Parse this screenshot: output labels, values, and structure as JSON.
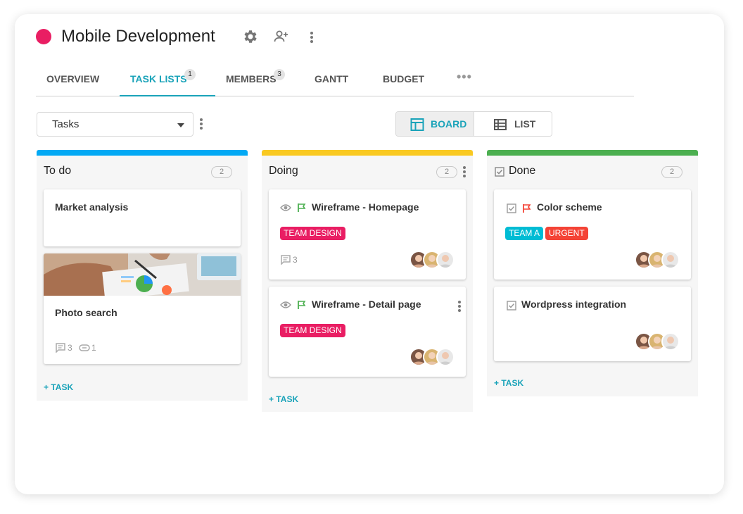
{
  "project": {
    "title": "Mobile Development",
    "accent": "#e91e63"
  },
  "header_icons": [
    "gear-icon",
    "add-user-icon",
    "more-vertical-icon"
  ],
  "tabs": [
    {
      "label": "OVERVIEW",
      "badge": ""
    },
    {
      "label": "TASK LISTS",
      "badge": "1",
      "active": true
    },
    {
      "label": "MEMBERS",
      "badge": "3"
    },
    {
      "label": "GANTT",
      "badge": ""
    },
    {
      "label": "BUDGET",
      "badge": ""
    }
  ],
  "list_select": {
    "value": "Tasks"
  },
  "view_toggle": {
    "board": "BOARD",
    "list": "LIST",
    "selected": "BOARD"
  },
  "colors": {
    "accent": "#1aa3b9",
    "todo": "#03a9f4",
    "doing": "#f9c921",
    "done": "#4caf50",
    "team_design": "#e91e63",
    "team_a": "#00bcd4",
    "urgent": "#f44336"
  },
  "columns": [
    {
      "name": "To do",
      "count": "2",
      "add_label": "+ TASK",
      "cards": [
        {
          "title": "Market analysis"
        },
        {
          "title": "Photo search",
          "comments": "3",
          "attachments": "1"
        }
      ]
    },
    {
      "name": "Doing",
      "count": "2",
      "add_label": "+ TASK",
      "cards": [
        {
          "title": "Wireframe - Homepage",
          "label": "TEAM DESIGN",
          "comments": "3"
        },
        {
          "title": "Wireframe - Detail page",
          "label": "TEAM DESIGN"
        }
      ]
    },
    {
      "name": "Done",
      "count": "2",
      "add_label": "+ TASK",
      "cards": [
        {
          "title": "Color scheme",
          "labels": [
            "TEAM A",
            "URGENT"
          ]
        },
        {
          "title": "Wordpress integration"
        }
      ]
    }
  ]
}
